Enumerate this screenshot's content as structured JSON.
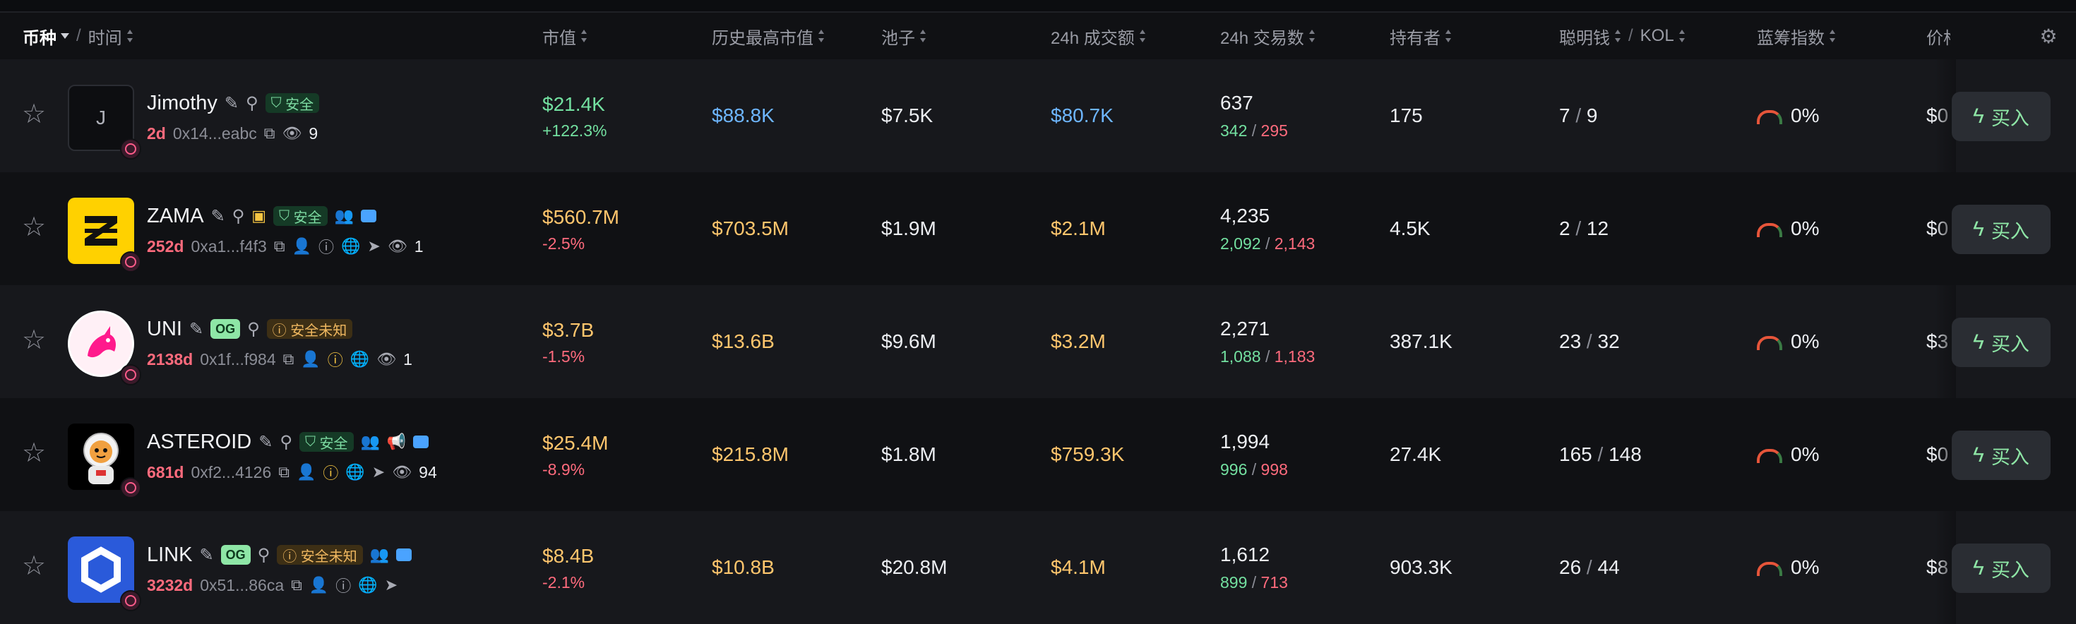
{
  "header": {
    "col_token": "币种",
    "col_time": "时间",
    "col_mcap": "市值",
    "col_ath": "历史最高市值",
    "col_pool": "池子",
    "col_vol": "24h 成交额",
    "col_txs": "24h 交易数",
    "col_holders": "持有者",
    "col_smart": "聪明钱",
    "col_kol": "KOL",
    "col_bluechip": "蓝筹指数",
    "col_price": "价格"
  },
  "rows": [
    {
      "logo_text": "J",
      "name": "Jimothy",
      "safety": "安全",
      "age": "2d",
      "addr": "0x14...eabc",
      "views": "9",
      "mcap": "$21.4K",
      "mcap_change": "+122.3%",
      "ath": "$88.8K",
      "pool": "$7.5K",
      "volume": "$80.7K",
      "txs": "637",
      "buys": "342",
      "sells": "295",
      "holders": "175",
      "smart": "7",
      "kol": "9",
      "bluechip": "0%",
      "price": "$0",
      "buy_label": "买入"
    },
    {
      "logo_text": "Z",
      "name": "ZAMA",
      "safety": "安全",
      "age": "252d",
      "addr": "0xa1...f4f3",
      "views": "1",
      "mcap": "$560.7M",
      "mcap_change": "-2.5%",
      "ath": "$703.5M",
      "pool": "$1.9M",
      "volume": "$2.1M",
      "txs": "4,235",
      "buys": "2,092",
      "sells": "2,143",
      "holders": "4.5K",
      "smart": "2",
      "kol": "12",
      "bluechip": "0%",
      "price": "$0",
      "buy_label": "买入"
    },
    {
      "name": "UNI",
      "og": "OG",
      "safety": "安全未知",
      "age": "2138d",
      "addr": "0x1f...f984",
      "views": "1",
      "mcap": "$3.7B",
      "mcap_change": "-1.5%",
      "ath": "$13.6B",
      "pool": "$9.6M",
      "volume": "$3.2M",
      "txs": "2,271",
      "buys": "1,088",
      "sells": "1,183",
      "holders": "387.1K",
      "smart": "23",
      "kol": "32",
      "bluechip": "0%",
      "price": "$3",
      "buy_label": "买入"
    },
    {
      "name": "ASTEROID",
      "safety": "安全",
      "age": "681d",
      "addr": "0xf2...4126",
      "views": "94",
      "mcap": "$25.4M",
      "mcap_change": "-8.9%",
      "ath": "$215.8M",
      "pool": "$1.8M",
      "volume": "$759.3K",
      "txs": "1,994",
      "buys": "996",
      "sells": "998",
      "holders": "27.4K",
      "smart": "165",
      "kol": "148",
      "bluechip": "0%",
      "price": "$0",
      "buy_label": "买入"
    },
    {
      "name": "LINK",
      "og": "OG",
      "safety": "安全未知",
      "age": "3232d",
      "addr": "0x51...86ca",
      "mcap": "$8.4B",
      "mcap_change": "-2.1%",
      "ath": "$10.8B",
      "pool": "$20.8M",
      "volume": "$4.1M",
      "txs": "1,612",
      "buys": "899",
      "sells": "713",
      "holders": "903.3K",
      "smart": "26",
      "kol": "44",
      "bluechip": "0%",
      "price": "$8",
      "buy_label": "买入"
    }
  ]
}
